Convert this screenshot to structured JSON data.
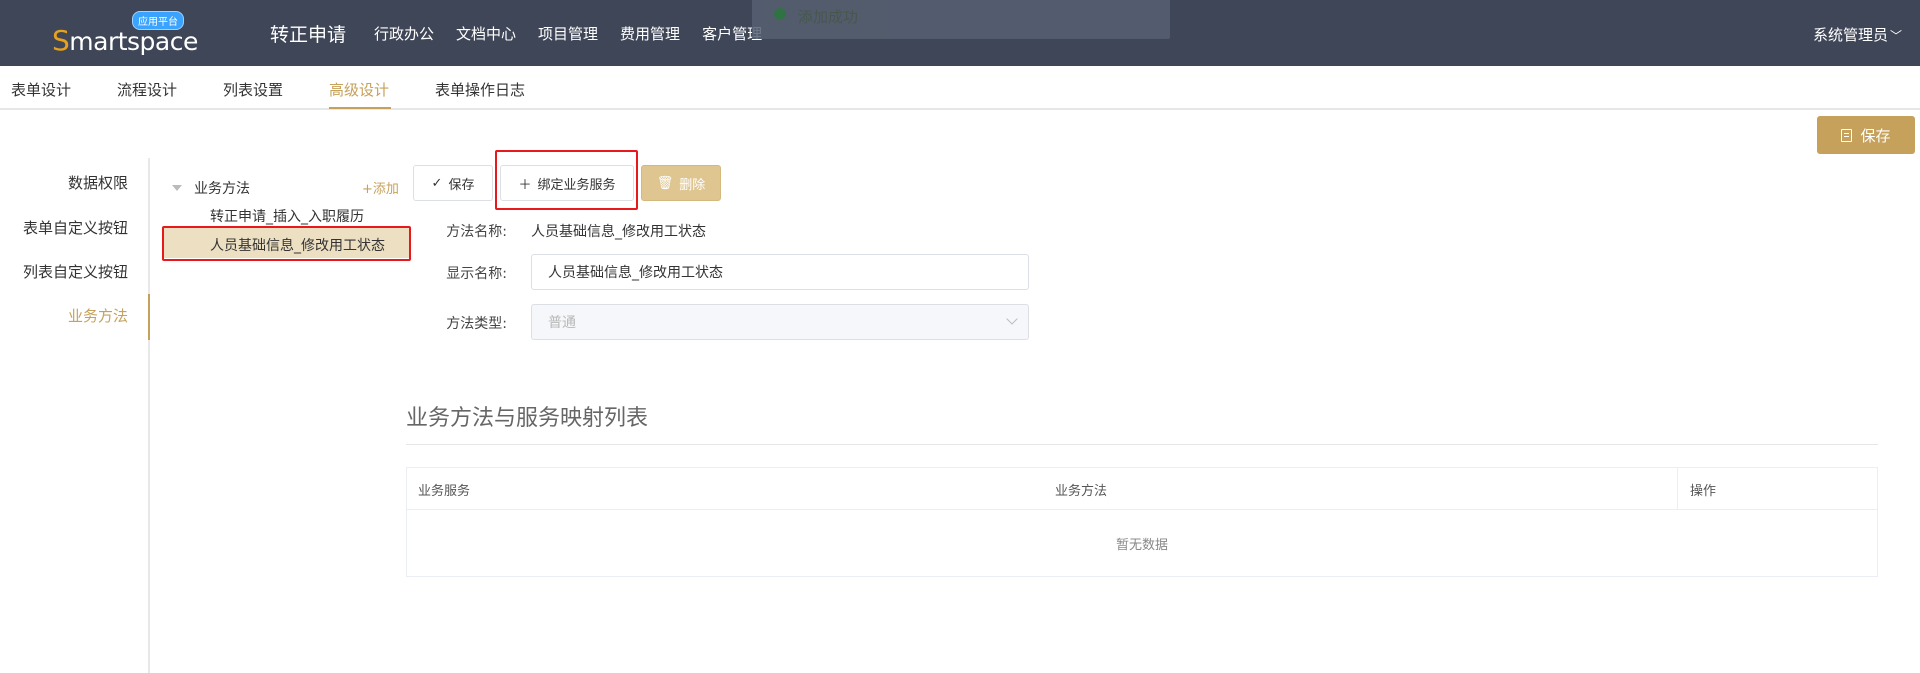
{
  "header": {
    "logo_text_first": "S",
    "logo_text_rest": "martspace",
    "logo_badge": "应用平台",
    "app_title": "转正申请",
    "nav": [
      "行政办公",
      "文档中心",
      "项目管理",
      "费用管理",
      "客户管理"
    ],
    "toast": "添加成功",
    "user": "系统管理员"
  },
  "tabs": [
    "表单设计",
    "流程设计",
    "列表设置",
    "高级设计",
    "表单操作日志"
  ],
  "active_tab": "高级设计",
  "toolbar": {
    "save_label": "保存"
  },
  "left_nav": {
    "items": [
      "数据权限",
      "表单自定义按钮",
      "列表自定义按钮",
      "业务方法"
    ],
    "active": "业务方法"
  },
  "tree": {
    "root_label": "业务方法",
    "add_label": "+添加",
    "nodes": [
      "转正申请_插入_入职履历",
      "人员基础信息_修改用工状态"
    ],
    "selected": "人员基础信息_修改用工状态"
  },
  "actions": {
    "save": "保存",
    "bind": "绑定业务服务",
    "delete": "删除"
  },
  "form": {
    "method_name_label": "方法名称:",
    "method_name_value": "人员基础信息_修改用工状态",
    "display_name_label": "显示名称:",
    "display_name_value": "人员基础信息_修改用工状态",
    "method_type_label": "方法类型:",
    "method_type_value": "普通"
  },
  "mapping": {
    "title": "业务方法与服务映射列表",
    "columns": [
      "业务服务",
      "业务方法",
      "操作"
    ],
    "empty_text": "暂无数据"
  },
  "colors": {
    "topbar": "#3f4657",
    "accent": "#c6a15b",
    "highlight": "#e8191c",
    "selected_bg": "#ecdfc2"
  }
}
